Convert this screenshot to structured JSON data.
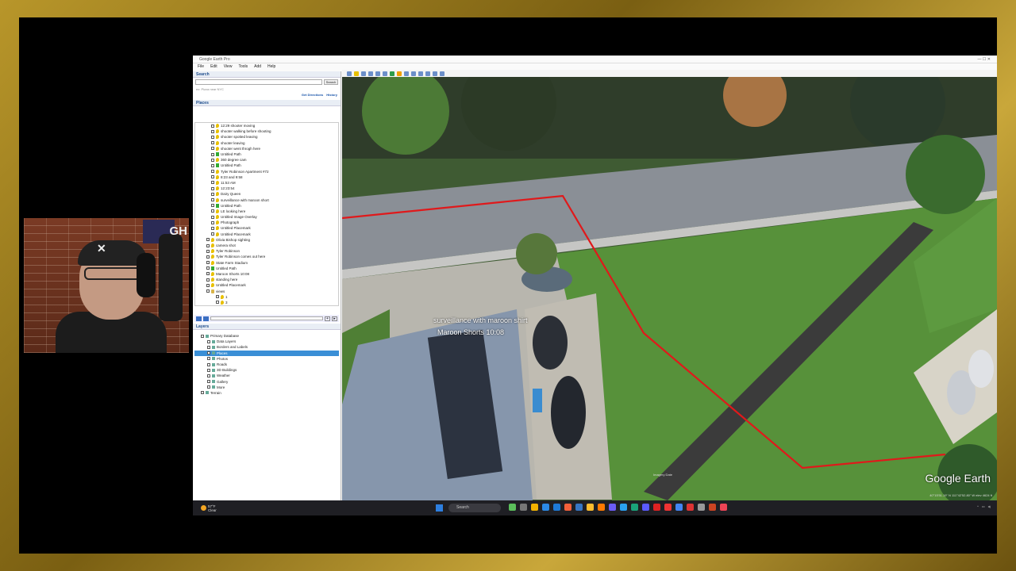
{
  "app": {
    "title": "Google Earth Pro",
    "menu": [
      "File",
      "Edit",
      "View",
      "Tools",
      "Add",
      "Help"
    ]
  },
  "search": {
    "header": "Search",
    "button": "Search",
    "hint": "ex: Pizza near NYC",
    "get_directions": "Get Directions",
    "history": "History"
  },
  "places": {
    "header": "Places",
    "items": [
      {
        "label": "12:29 shooter moving",
        "type": "pin"
      },
      {
        "label": "shooter walking before shooting",
        "type": "pin"
      },
      {
        "label": "shooter spotted leaving",
        "type": "pin"
      },
      {
        "label": "shooter leaving",
        "type": "pin"
      },
      {
        "label": "shooter went throgh here",
        "type": "pin"
      },
      {
        "label": "Untitled Path",
        "type": "path"
      },
      {
        "label": "360 degree cam",
        "type": "pin"
      },
      {
        "label": "Untitled Path",
        "type": "path"
      },
      {
        "label": "Tyler Robinson Apartment #72",
        "type": "pin"
      },
      {
        "label": "8:23 and 9:58",
        "type": "pin"
      },
      {
        "label": "11:53 AM",
        "type": "pin"
      },
      {
        "label": "12:23:54",
        "type": "pin"
      },
      {
        "label": "Dairy Queen",
        "type": "pin"
      },
      {
        "label": "surveillance with maroon short",
        "type": "pin"
      },
      {
        "label": "Untitled Path",
        "type": "path"
      },
      {
        "label": "LE looking here",
        "type": "pin"
      },
      {
        "label": "Untitled Image Overlay",
        "type": "pin"
      },
      {
        "label": "Photograph",
        "type": "pin"
      },
      {
        "label": "Untitled Placemark",
        "type": "pin"
      },
      {
        "label": "Untitled Placemark",
        "type": "pin"
      },
      {
        "label": "Olivia Bishop sighting",
        "type": "pin",
        "level": "top"
      },
      {
        "label": "camera shot",
        "type": "pin",
        "level": "top"
      },
      {
        "label": "Tyler Robinson",
        "type": "pin",
        "level": "top"
      },
      {
        "label": "Tyler Robinson comes out here",
        "type": "pin",
        "level": "top"
      },
      {
        "label": "State Farm Stadium",
        "type": "pin",
        "level": "top"
      },
      {
        "label": "Untitled Path",
        "type": "path",
        "level": "top"
      },
      {
        "label": "Maroon Shorts 10:08",
        "type": "pin",
        "level": "top"
      },
      {
        "label": "standing here",
        "type": "pin",
        "level": "top"
      },
      {
        "label": "Untitled Placemark",
        "type": "pin",
        "level": "top"
      },
      {
        "label": "views",
        "type": "folder",
        "level": "top"
      },
      {
        "label": "1",
        "type": "pin",
        "level": "sub"
      },
      {
        "label": "3",
        "type": "pin",
        "level": "sub"
      }
    ]
  },
  "layers": {
    "header": "Layers",
    "items": [
      {
        "label": "Primary Database",
        "indent": false
      },
      {
        "label": "Data Layers",
        "indent": true
      },
      {
        "label": "Borders and Labels",
        "indent": true
      },
      {
        "label": "Places",
        "indent": true,
        "selected": true
      },
      {
        "label": "Photos",
        "indent": true
      },
      {
        "label": "Roads",
        "indent": true
      },
      {
        "label": "3D Buildings",
        "indent": true
      },
      {
        "label": "Weather",
        "indent": true
      },
      {
        "label": "Gallery",
        "indent": true
      },
      {
        "label": "More",
        "indent": true
      },
      {
        "label": "Terrain",
        "indent": false
      }
    ]
  },
  "map": {
    "label_surveillance": "surveillance with maroon shirt",
    "label_maroon": "Maroon Shorts 10:08",
    "logo": "Google Earth",
    "status": "40°15'51.19\" N  111°42'52.80\" W  elev 4624 ft",
    "image_date": "Imagery Date",
    "path_color": "#e0191b"
  },
  "taskbar": {
    "temp": "57°F",
    "condition": "Clear",
    "search": "Search",
    "icon_colors": [
      "#5bbf5b",
      "#777",
      "#f2b200",
      "#2b8ae6",
      "#1e7ad6",
      "#f25f3a",
      "#3776c3",
      "#ffbd2e",
      "#ff7a00",
      "#6b5cf6",
      "#2aa0f0",
      "#1aa37a",
      "#5a5aff",
      "#d22",
      "#e33",
      "#4285f4",
      "#d33",
      "#999",
      "#c42",
      "#e45"
    ]
  }
}
